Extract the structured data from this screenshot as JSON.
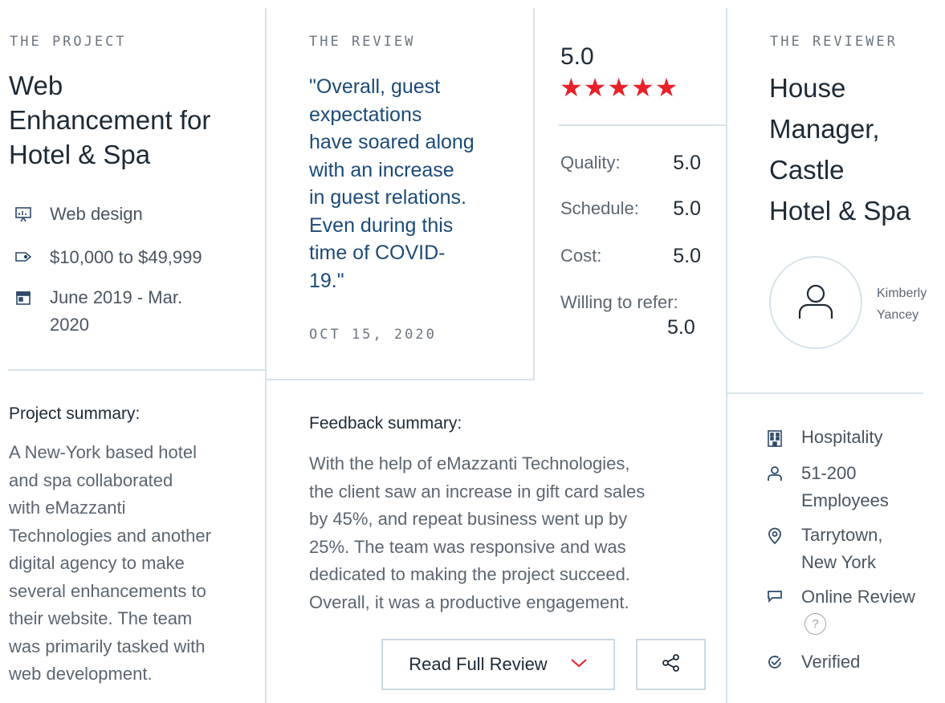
{
  "project": {
    "eyebrow": "THE PROJECT",
    "title_lines": [
      "Web",
      "Enhancement for",
      "Hotel & Spa"
    ],
    "service": "Web design",
    "budget": "$10,000 to $49,999",
    "dates_line1": "June 2019 - Mar.",
    "dates_line2": "2020",
    "summary_label": "Project summary:",
    "summary_lines": [
      "A New-York based hotel",
      "and spa collaborated",
      "with eMazzanti",
      "Technologies and another",
      "digital agency to make",
      "several enhancements to",
      "their website. The team",
      "was primarily tasked with",
      "web development."
    ]
  },
  "review": {
    "eyebrow": "THE REVIEW",
    "quote_lines": [
      "\"Overall, guest",
      "expectations",
      "have soared along",
      "with an increase",
      "in guest relations.",
      "Even during this",
      "time of COVID-",
      "19.\""
    ],
    "date": "OCT 15, 2020",
    "overall_rating": "5.0",
    "star_count": 5,
    "star_color": "#e8202a",
    "scores": [
      {
        "label": "Quality:",
        "value": "5.0"
      },
      {
        "label": "Schedule:",
        "value": "5.0"
      },
      {
        "label": "Cost:",
        "value": "5.0"
      }
    ],
    "refer_label": "Willing to refer:",
    "refer_value": "5.0",
    "feedback_label": "Feedback summary:",
    "feedback_lines": [
      "With the help of eMazzanti Technologies,",
      "the client saw an increase in gift card sales",
      "by 45%, and repeat business went up by",
      "25%. The team was responsive and was",
      "dedicated to making the project succeed.",
      "Overall, it was a productive engagement."
    ],
    "read_full_label": "Read Full Review",
    "accent_color": "#e8202a"
  },
  "reviewer": {
    "eyebrow": "THE REVIEWER",
    "title_lines": [
      "House",
      "Manager,",
      "Castle",
      "Hotel & Spa"
    ],
    "name_line1": "Kimberly",
    "name_line2": "Yancey",
    "industry": "Hospitality",
    "size_line1": "51-200",
    "size_line2": "Employees",
    "location_line1": "Tarrytown,",
    "location_line2": "New York",
    "review_type": "Online Review",
    "help_glyph": "?",
    "verified": "Verified"
  },
  "icons": {
    "service": "presentation-icon",
    "budget": "price-tag-icon",
    "dates": "calendar-icon",
    "avatar": "user-icon",
    "industry": "building-icon",
    "size": "person-icon",
    "location": "location-pin-icon",
    "review_type": "chat-bubble-icon",
    "help": "question-circle-icon",
    "verified": "check-circle-icon",
    "dropdown": "chevron-down-icon",
    "share": "share-icon"
  },
  "colors": {
    "quote": "#1b4a78",
    "divider": "#d6e3ea",
    "icon": "#2e4a6b"
  }
}
